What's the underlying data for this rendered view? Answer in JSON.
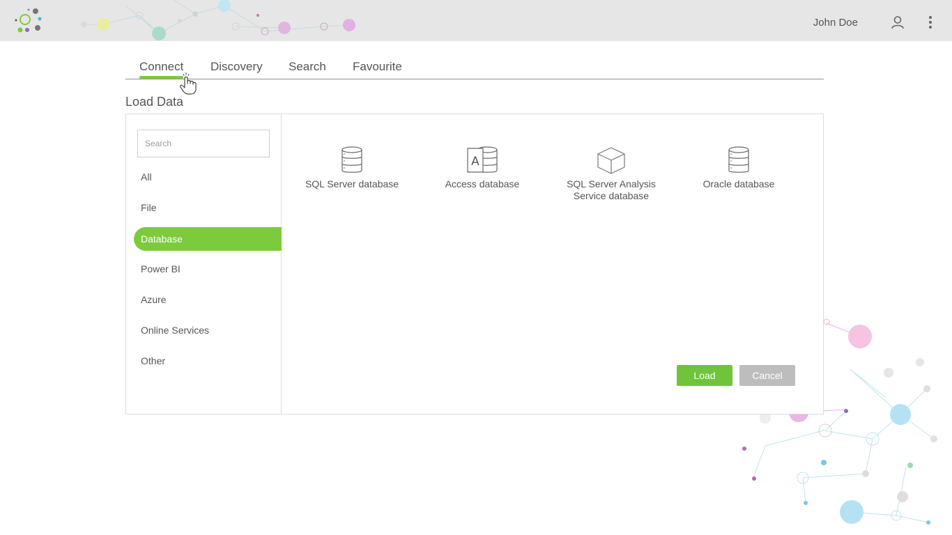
{
  "header": {
    "user_name": "John Doe"
  },
  "tabs": [
    {
      "label": "Connect",
      "active": true
    },
    {
      "label": "Discovery",
      "active": false
    },
    {
      "label": "Search",
      "active": false
    },
    {
      "label": "Favourite",
      "active": false
    }
  ],
  "section_title": "Load Data",
  "search": {
    "placeholder": "Search",
    "value": ""
  },
  "categories": [
    {
      "label": "All",
      "active": false
    },
    {
      "label": "File",
      "active": false
    },
    {
      "label": "Database",
      "active": true
    },
    {
      "label": "Power BI",
      "active": false
    },
    {
      "label": "Azure",
      "active": false
    },
    {
      "label": "Online Services",
      "active": false
    },
    {
      "label": "Other",
      "active": false
    }
  ],
  "sources": [
    {
      "label": "SQL Server database",
      "icon": "database-icon"
    },
    {
      "label": "Access database",
      "icon": "access-database-icon"
    },
    {
      "label_line1": "SQL Server Analysis",
      "label_line2": "Service database",
      "icon": "cube-icon"
    },
    {
      "label": "Oracle database",
      "icon": "database-icon"
    }
  ],
  "buttons": {
    "load": "Load",
    "cancel": "Cancel"
  },
  "colors": {
    "accent": "#7ccb3c",
    "header_bg": "#e6e6e6",
    "cancel_bg": "#bdbdbd"
  }
}
